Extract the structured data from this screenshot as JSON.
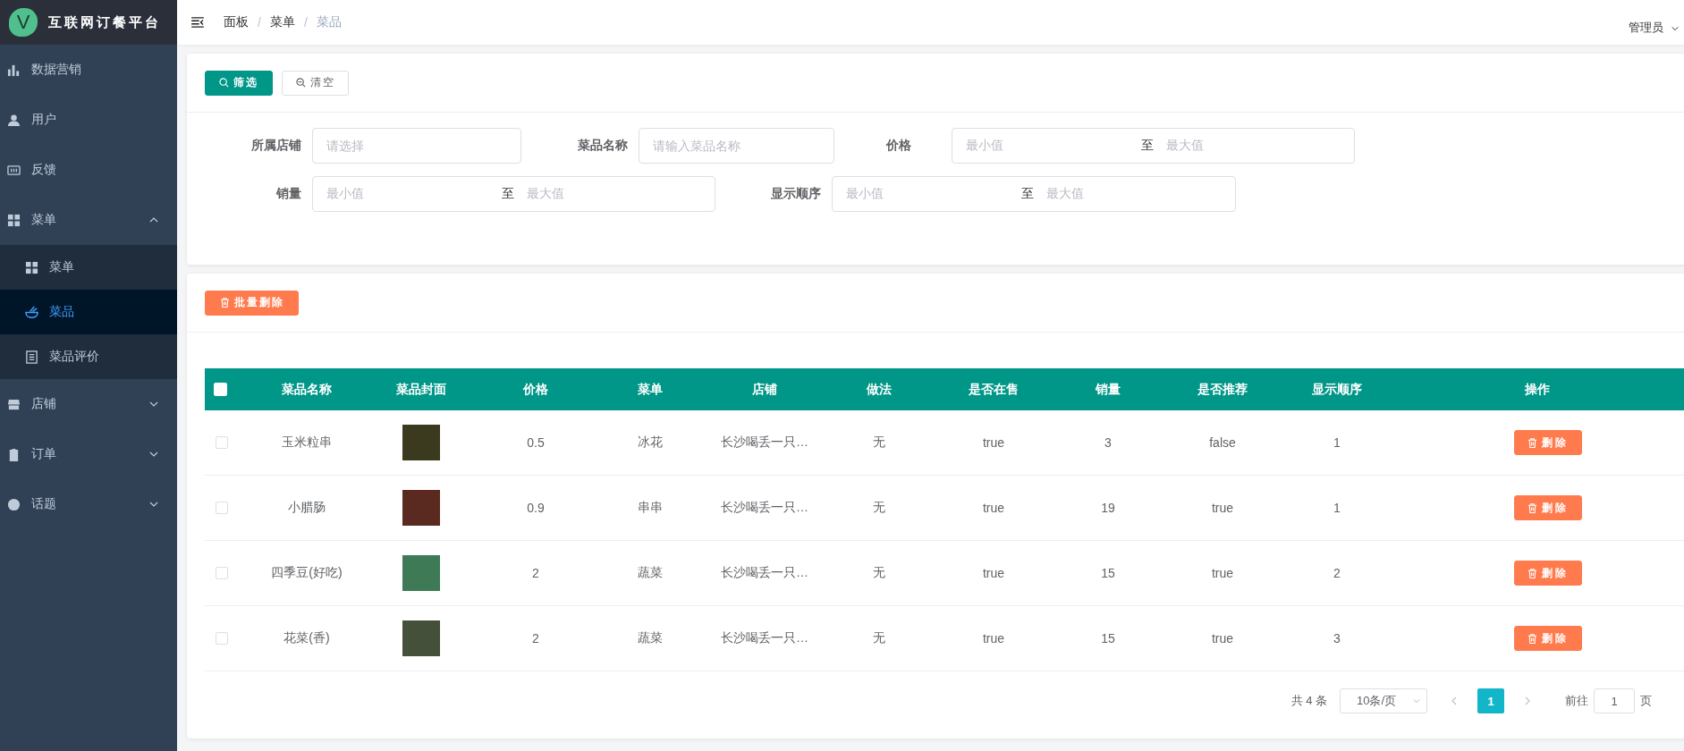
{
  "brand": {
    "logo_letter": "V",
    "title": "互联网订餐平台"
  },
  "sidebar": {
    "items": [
      {
        "label": "数据营销",
        "selected": false
      },
      {
        "label": "用户",
        "selected": false
      },
      {
        "label": "反馈",
        "selected": false
      },
      {
        "label": "菜单",
        "selected": false,
        "expanded": true,
        "children": [
          {
            "label": "菜单",
            "selected": false
          },
          {
            "label": "菜品",
            "selected": true
          },
          {
            "label": "菜品评价",
            "selected": false
          }
        ]
      },
      {
        "label": "店铺",
        "selected": false,
        "expanded": false
      },
      {
        "label": "订单",
        "selected": false,
        "expanded": false
      },
      {
        "label": "话题",
        "selected": false,
        "expanded": false
      }
    ]
  },
  "header": {
    "breadcrumb": [
      "面板",
      "菜单",
      "菜品"
    ],
    "breadcrumb_separator": "/",
    "user": "管理员"
  },
  "filter": {
    "buttons": [
      {
        "label": "筛选",
        "kind": "primary"
      },
      {
        "label": "清空",
        "kind": "plain"
      }
    ],
    "fields": [
      {
        "label": "所属店铺",
        "kind": "select",
        "placeholder": "请选择"
      },
      {
        "label": "菜品名称",
        "kind": "text",
        "placeholder": "请输入菜品名称"
      },
      {
        "label": "价格",
        "kind": "range",
        "min_placeholder": "最小值",
        "separator": "至",
        "max_placeholder": "最大值"
      },
      {
        "label": "销量",
        "kind": "range",
        "min_placeholder": "最小值",
        "separator": "至",
        "max_placeholder": "最大值"
      },
      {
        "label": "显示顺序",
        "kind": "range",
        "min_placeholder": "最小值",
        "separator": "至",
        "max_placeholder": "最大值"
      }
    ]
  },
  "table": {
    "batch_delete": "批量删除",
    "select_all_checked": false,
    "columns": [
      "菜品名称",
      "菜品封面",
      "价格",
      "菜单",
      "店铺",
      "做法",
      "是否在售",
      "销量",
      "是否推荐",
      "显示顺序",
      "操作"
    ],
    "rows": [
      {
        "checked": false,
        "name": "玉米粒串",
        "price": "0.5",
        "menu": "冰花",
        "shop": "长沙喝丢一只…",
        "method": "无",
        "on_sale": "true",
        "sales": "3",
        "recommended": "false",
        "order": "1",
        "action": "删除"
      },
      {
        "checked": false,
        "name": "小腊肠",
        "price": "0.9",
        "menu": "串串",
        "shop": "长沙喝丢一只…",
        "method": "无",
        "on_sale": "true",
        "sales": "19",
        "recommended": "true",
        "order": "1",
        "action": "删除"
      },
      {
        "checked": false,
        "name": "四季豆(好吃)",
        "price": "2",
        "menu": "蔬菜",
        "shop": "长沙喝丢一只…",
        "method": "无",
        "on_sale": "true",
        "sales": "15",
        "recommended": "true",
        "order": "2",
        "action": "删除"
      },
      {
        "checked": false,
        "name": "花菜(香)",
        "price": "2",
        "menu": "蔬菜",
        "shop": "长沙喝丢一只…",
        "method": "无",
        "on_sale": "true",
        "sales": "15",
        "recommended": "true",
        "order": "3",
        "action": "删除"
      }
    ]
  },
  "pagination": {
    "total": "共 4 条",
    "page_size": "10条/页",
    "prev_disabled": true,
    "next_disabled": true,
    "pages": [
      {
        "label": "1",
        "selected": true
      }
    ],
    "jump_label": "前往",
    "jump_value": "1",
    "jump_suffix": "页"
  }
}
